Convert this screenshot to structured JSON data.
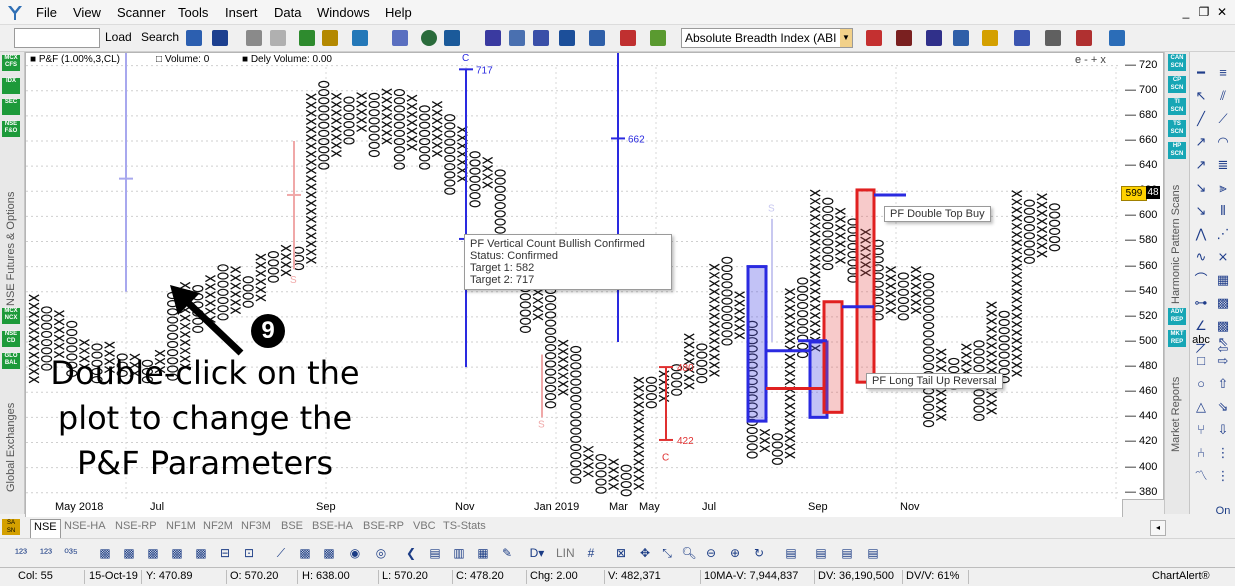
{
  "menu": {
    "items": [
      "File",
      "View",
      "Scanner",
      "Tools",
      "Insert",
      "Data",
      "Windows",
      "Help"
    ]
  },
  "toolbar": {
    "load_label": "Load",
    "search_label": "Search",
    "indicator_value": "Absolute Breadth Index (ABI"
  },
  "chart_header": {
    "title": "P&F (1.00%,3,CL)",
    "volume": "Volume: 0",
    "dely_volume": "Dely Volume: 0.00",
    "controls": "e - + x"
  },
  "left_sidebar": {
    "buttons": [
      "MCX CFS",
      "IDX",
      "SEC",
      "NSE F&O",
      "MCX NCX",
      "NSE CD",
      "GLO BAL"
    ],
    "vertical_labels": [
      "NSE Futures & Options",
      "Global Exchanges"
    ]
  },
  "right_sidebar": {
    "buttons": [
      "CAN SCN",
      "CP SCN",
      "TI SCN",
      "TS SCN",
      "HP SCN",
      "ADV REP",
      "MKT REP"
    ],
    "vertical_labels": [
      "Harmonic Pattern Scans",
      "Market Reports"
    ]
  },
  "right_panel": {
    "abc_label": "abc",
    "on_label": "On"
  },
  "x_axis": {
    "labels": [
      "May 2018",
      "Jul",
      "Sep",
      "Nov",
      "Jan 2019",
      "Mar",
      "May",
      "Jul",
      "Sep",
      "Nov"
    ]
  },
  "y_axis": {
    "labels": [
      "720",
      "700",
      "680",
      "660",
      "640",
      "620",
      "600",
      "580",
      "560",
      "540",
      "520",
      "500",
      "480",
      "460",
      "440",
      "420",
      "400",
      "380"
    ],
    "price_tag": "599",
    "price_tag2": "48"
  },
  "annotations": {
    "level_717": "717",
    "level_582": "582",
    "level_662": "662",
    "level_480": "480",
    "level_422": "422",
    "marker_c1": "C",
    "marker_c2": "C",
    "marker_s1": "S",
    "marker_s2": "S",
    "marker_s3": "S"
  },
  "popups": {
    "vertical_count": {
      "title": "PF Vertical Count Bullish Confirmed",
      "status": "Status: Confirmed",
      "target1": "Target 1: 582",
      "target2": "Target 2: 717"
    },
    "double_top": "PF Double Top Buy",
    "long_tail": "PF Long Tail Up Reversal"
  },
  "callout": {
    "number": "9",
    "text": "Double-click on the plot to change the P&F Parameters"
  },
  "tabs": [
    "NSE",
    "NSE-HA",
    "NSE-RP",
    "NF1M",
    "NF2M",
    "NF3M",
    "BSE",
    "BSE-HA",
    "BSE-RP",
    "VBC",
    "TS-Stats"
  ],
  "status_bar": {
    "col": "Col: 55",
    "date": "15-Oct-19",
    "y": "Y: 470.89",
    "open": "O: 570.20",
    "high": "H: 638.00",
    "low": "L: 570.20",
    "close": "C: 478.20",
    "chg": "Chg: 2.00",
    "volume": "V: 482,371",
    "ma": "10MA-V: 7,944,837",
    "dv": "DV: 36,190,500",
    "dvv": "DV/V: 61%",
    "brand": "ChartAlert®"
  },
  "chart_data": {
    "type": "point-and-figure",
    "title": "P&F (1.00%,3,CL)",
    "ylim": [
      375,
      730
    ],
    "y_ticks": [
      380,
      400,
      420,
      440,
      460,
      480,
      500,
      520,
      540,
      560,
      580,
      600,
      620,
      640,
      660,
      680,
      700,
      720
    ],
    "x_labels": [
      "May 2018",
      "Jul",
      "Sep",
      "Nov",
      "Jan 2019",
      "Mar",
      "May",
      "Jul",
      "Sep",
      "Nov"
    ],
    "columns": [
      {
        "t": "X",
        "lo": 470,
        "hi": 535
      },
      {
        "t": "O",
        "lo": 480,
        "hi": 530
      },
      {
        "t": "X",
        "lo": 490,
        "hi": 525
      },
      {
        "t": "O",
        "lo": 475,
        "hi": 515
      },
      {
        "t": "X",
        "lo": 480,
        "hi": 505
      },
      {
        "t": "O",
        "lo": 470,
        "hi": 500
      },
      {
        "t": "X",
        "lo": 478,
        "hi": 500
      },
      {
        "t": "O",
        "lo": 475,
        "hi": 492
      },
      {
        "t": "X",
        "lo": 475,
        "hi": 490
      },
      {
        "t": "O",
        "lo": 470,
        "hi": 488
      },
      {
        "t": "X",
        "lo": 478,
        "hi": 495
      },
      {
        "t": "O",
        "lo": 472,
        "hi": 540
      },
      {
        "t": "X",
        "lo": 480,
        "hi": 550
      },
      {
        "t": "O",
        "lo": 510,
        "hi": 548
      },
      {
        "t": "X",
        "lo": 518,
        "hi": 555
      },
      {
        "t": "O",
        "lo": 520,
        "hi": 560
      },
      {
        "t": "X",
        "lo": 525,
        "hi": 560
      },
      {
        "t": "O",
        "lo": 530,
        "hi": 555
      },
      {
        "t": "X",
        "lo": 535,
        "hi": 570
      },
      {
        "t": "O",
        "lo": 550,
        "hi": 575
      },
      {
        "t": "X",
        "lo": 555,
        "hi": 580
      },
      {
        "t": "O",
        "lo": 560,
        "hi": 578
      },
      {
        "t": "X",
        "lo": 565,
        "hi": 700
      },
      {
        "t": "O",
        "lo": 640,
        "hi": 705
      },
      {
        "t": "X",
        "lo": 650,
        "hi": 700
      },
      {
        "t": "O",
        "lo": 660,
        "hi": 695
      },
      {
        "t": "X",
        "lo": 670,
        "hi": 700
      },
      {
        "t": "O",
        "lo": 650,
        "hi": 700
      },
      {
        "t": "X",
        "lo": 660,
        "hi": 705
      },
      {
        "t": "O",
        "lo": 640,
        "hi": 700
      },
      {
        "t": "X",
        "lo": 655,
        "hi": 700
      },
      {
        "t": "O",
        "lo": 640,
        "hi": 690
      },
      {
        "t": "X",
        "lo": 650,
        "hi": 690
      },
      {
        "t": "O",
        "lo": 620,
        "hi": 680
      },
      {
        "t": "X",
        "lo": 630,
        "hi": 670
      },
      {
        "t": "O",
        "lo": 610,
        "hi": 650
      },
      {
        "t": "X",
        "lo": 625,
        "hi": 650
      },
      {
        "t": "O",
        "lo": 550,
        "hi": 640
      },
      {
        "t": "X",
        "lo": 560,
        "hi": 580
      },
      {
        "t": "O",
        "lo": 510,
        "hi": 570
      },
      {
        "t": "X",
        "lo": 520,
        "hi": 555
      },
      {
        "t": "O",
        "lo": 450,
        "hi": 545
      },
      {
        "t": "X",
        "lo": 460,
        "hi": 500
      },
      {
        "t": "O",
        "lo": 390,
        "hi": 495
      },
      {
        "t": "X",
        "lo": 395,
        "hi": 420
      },
      {
        "t": "O",
        "lo": 382,
        "hi": 412
      },
      {
        "t": "X",
        "lo": 385,
        "hi": 405
      },
      {
        "t": "O",
        "lo": 380,
        "hi": 400
      },
      {
        "t": "X",
        "lo": 385,
        "hi": 475
      },
      {
        "t": "O",
        "lo": 450,
        "hi": 470
      },
      {
        "t": "X",
        "lo": 455,
        "hi": 480
      },
      {
        "t": "O",
        "lo": 460,
        "hi": 480
      },
      {
        "t": "X",
        "lo": 465,
        "hi": 505
      },
      {
        "t": "O",
        "lo": 470,
        "hi": 500
      },
      {
        "t": "X",
        "lo": 475,
        "hi": 560
      },
      {
        "t": "O",
        "lo": 500,
        "hi": 565
      },
      {
        "t": "X",
        "lo": 505,
        "hi": 540
      },
      {
        "t": "O",
        "lo": 410,
        "hi": 515
      },
      {
        "t": "X",
        "lo": 415,
        "hi": 430
      },
      {
        "t": "O",
        "lo": 405,
        "hi": 425
      },
      {
        "t": "X",
        "lo": 410,
        "hi": 545
      },
      {
        "t": "O",
        "lo": 490,
        "hi": 550
      },
      {
        "t": "X",
        "lo": 495,
        "hi": 620
      },
      {
        "t": "O",
        "lo": 560,
        "hi": 615
      },
      {
        "t": "X",
        "lo": 565,
        "hi": 610
      },
      {
        "t": "O",
        "lo": 550,
        "hi": 600
      },
      {
        "t": "X",
        "lo": 555,
        "hi": 590
      },
      {
        "t": "O",
        "lo": 520,
        "hi": 580
      },
      {
        "t": "X",
        "lo": 525,
        "hi": 560
      },
      {
        "t": "O",
        "lo": 520,
        "hi": 555
      },
      {
        "t": "X",
        "lo": 525,
        "hi": 560
      },
      {
        "t": "O",
        "lo": 435,
        "hi": 555
      },
      {
        "t": "X",
        "lo": 440,
        "hi": 495
      },
      {
        "t": "O",
        "lo": 465,
        "hi": 490
      },
      {
        "t": "X",
        "lo": 470,
        "hi": 500
      },
      {
        "t": "O",
        "lo": 440,
        "hi": 500
      },
      {
        "t": "X",
        "lo": 445,
        "hi": 530
      },
      {
        "t": "O",
        "lo": 470,
        "hi": 525
      },
      {
        "t": "X",
        "lo": 475,
        "hi": 620
      },
      {
        "t": "O",
        "lo": 565,
        "hi": 615
      },
      {
        "t": "X",
        "lo": 570,
        "hi": 620
      },
      {
        "t": "O",
        "lo": 575,
        "hi": 610
      }
    ]
  }
}
